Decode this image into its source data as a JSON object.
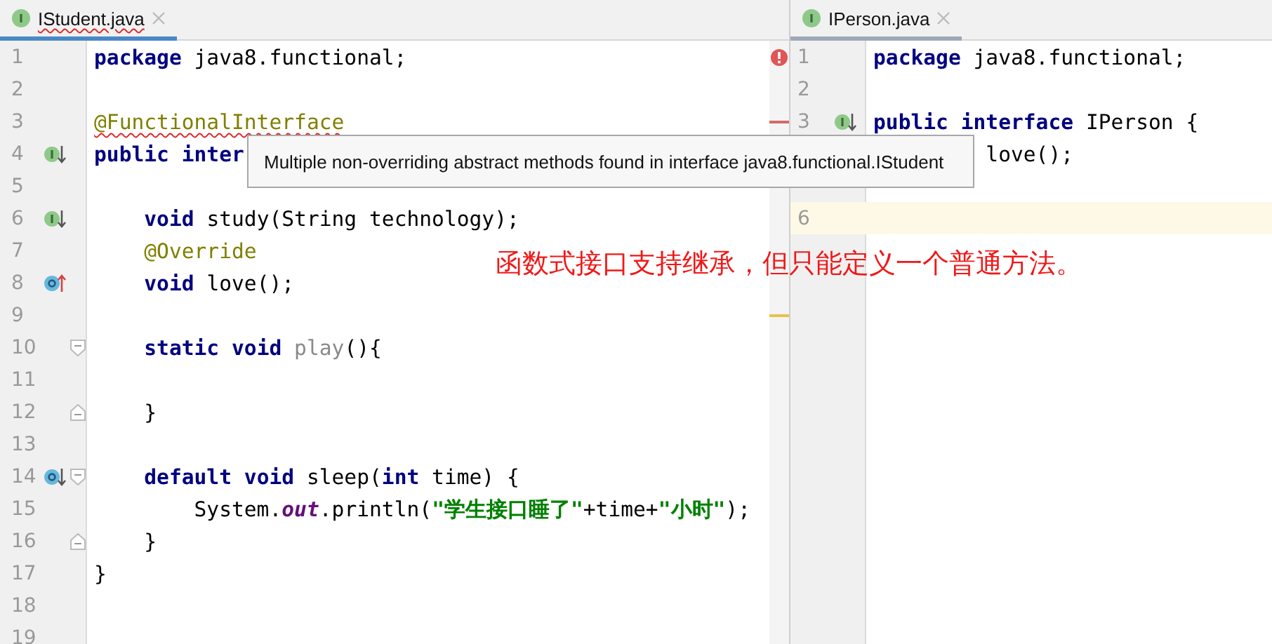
{
  "panes": [
    {
      "tab": {
        "title": "IStudent.java",
        "selected": true,
        "error": true
      },
      "lines": [
        {
          "kind": "code",
          "number": "1",
          "tokens": [
            {
              "kind": "keyword",
              "text": "package"
            },
            {
              "kind": "plain",
              "text": " java8.functional;"
            }
          ],
          "stripe": {
            "kind": "error-badge"
          }
        },
        {
          "kind": "code",
          "number": "2"
        },
        {
          "kind": "code",
          "number": "3",
          "tokens": [
            {
              "kind": "annotation",
              "text": "@FunctionalInterface",
              "error": true
            }
          ],
          "stripe": {
            "kind": "error"
          }
        },
        {
          "kind": "code",
          "number": "4",
          "gutter_icon": {
            "kind": "implemented"
          },
          "tokens": [
            {
              "kind": "keyword",
              "text": "public"
            },
            {
              "kind": "keyword",
              "text": " inter"
            }
          ]
        },
        {
          "kind": "code",
          "number": "5"
        },
        {
          "kind": "code",
          "number": "6",
          "gutter_icon": {
            "kind": "implemented"
          },
          "tokens": [
            {
              "kind": "keyword",
              "text": "    void"
            },
            {
              "kind": "plain",
              "text": " study(String technology);"
            }
          ]
        },
        {
          "kind": "code",
          "number": "7",
          "tokens": [
            {
              "kind": "annotation",
              "text": "    @Override"
            }
          ]
        },
        {
          "kind": "code",
          "number": "8",
          "gutter_icon": {
            "kind": "overriding"
          },
          "tokens": [
            {
              "kind": "keyword",
              "text": "    void"
            },
            {
              "kind": "plain",
              "text": " love();"
            }
          ]
        },
        {
          "kind": "code",
          "number": "9",
          "stripe": {
            "kind": "warning"
          }
        },
        {
          "kind": "code",
          "number": "10",
          "fold": {
            "kind": "start"
          },
          "tokens": [
            {
              "kind": "keyword",
              "text": "    static"
            },
            {
              "kind": "keyword",
              "text": " void"
            },
            {
              "kind": "unused",
              "text": " play"
            },
            {
              "kind": "plain",
              "text": "(){"
            }
          ]
        },
        {
          "kind": "code",
          "number": "11"
        },
        {
          "kind": "code",
          "number": "12",
          "fold": {
            "kind": "end"
          },
          "tokens": [
            {
              "kind": "plain",
              "text": "    }"
            }
          ]
        },
        {
          "kind": "code",
          "number": "13"
        },
        {
          "kind": "code",
          "number": "14",
          "gutter_icon": {
            "kind": "implemented-method"
          },
          "fold": {
            "kind": "start"
          },
          "tokens": [
            {
              "kind": "keyword",
              "text": "    default"
            },
            {
              "kind": "keyword",
              "text": " void"
            },
            {
              "kind": "plain",
              "text": " sleep("
            },
            {
              "kind": "keyword",
              "text": "int"
            },
            {
              "kind": "plain",
              "text": " time) {"
            }
          ]
        },
        {
          "kind": "code",
          "number": "15",
          "tokens": [
            {
              "kind": "plain",
              "text": "        System."
            },
            {
              "kind": "static-field",
              "text": "out"
            },
            {
              "kind": "plain",
              "text": ".println("
            },
            {
              "kind": "string",
              "text": "\"学生接口睡了\""
            },
            {
              "kind": "plain",
              "text": "+time+"
            },
            {
              "kind": "string",
              "text": "\"小时\""
            },
            {
              "kind": "plain",
              "text": ");"
            }
          ]
        },
        {
          "kind": "code",
          "number": "16",
          "fold": {
            "kind": "end"
          },
          "tokens": [
            {
              "kind": "plain",
              "text": "    }"
            }
          ]
        },
        {
          "kind": "code",
          "number": "17",
          "tokens": [
            {
              "kind": "plain",
              "text": "}"
            }
          ]
        },
        {
          "kind": "code",
          "number": "18"
        },
        {
          "kind": "code",
          "number": "19"
        }
      ]
    },
    {
      "tab": {
        "title": "IPerson.java",
        "selected": false,
        "error": false
      },
      "lines": [
        {
          "kind": "code",
          "number": "1",
          "tokens": [
            {
              "kind": "keyword",
              "text": "package"
            },
            {
              "kind": "plain",
              "text": " java8.functional;"
            }
          ]
        },
        {
          "kind": "code",
          "number": "2"
        },
        {
          "kind": "code",
          "number": "3",
          "gutter_icon": {
            "kind": "implemented"
          },
          "tokens": [
            {
              "kind": "keyword",
              "text": "public"
            },
            {
              "kind": "keyword",
              "text": " interface"
            },
            {
              "kind": "plain",
              "text": " IPerson {"
            }
          ]
        },
        {
          "kind": "code",
          "tokens": [
            {
              "kind": "plain",
              "text": "         love();"
            }
          ]
        },
        {
          "kind": "blank"
        },
        {
          "kind": "code",
          "number": "6",
          "current": true
        }
      ]
    }
  ],
  "tooltip": {
    "text": "Multiple non-overriding abstract methods found in interface java8.functional.IStudent"
  },
  "annotation": {
    "text": "函数式接口支持继承，但只能定义一个普通方法。"
  }
}
